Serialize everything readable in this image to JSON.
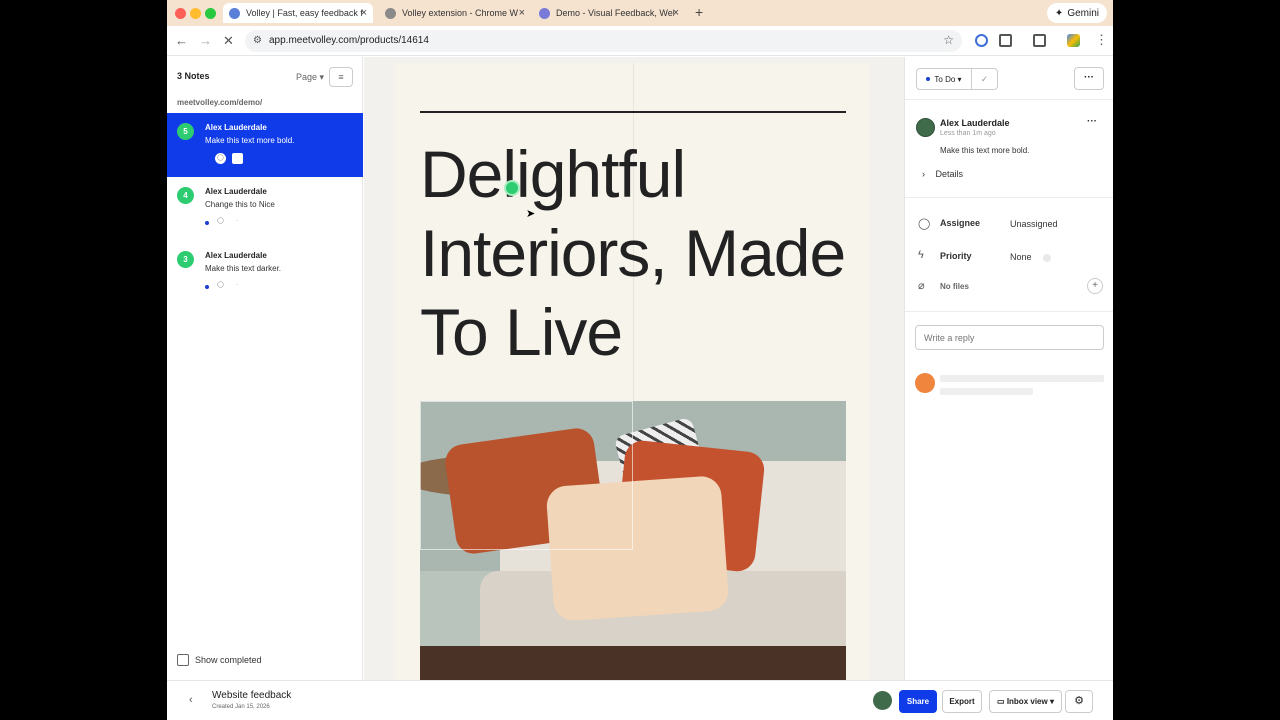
{
  "browser": {
    "tabs": [
      {
        "label": "Volley | Fast, easy feedback f",
        "active": true
      },
      {
        "label": "Volley extension - Chrome W",
        "active": false
      },
      {
        "label": "Demo - Visual Feedback, Web",
        "active": false
      }
    ],
    "gemini_label": "Gemini",
    "url": "app.meetvolley.com/products/14614"
  },
  "left_panel": {
    "notes_count": "3 Notes",
    "page_filter": "Page",
    "site_url": "meetvolley.com/demo/",
    "notes": [
      {
        "number": "5",
        "author": "Alex Lauderdale",
        "message": "Make this text more bold.",
        "selected": true
      },
      {
        "number": "4",
        "author": "Alex Lauderdale",
        "message": "Change this to Nice",
        "selected": false
      },
      {
        "number": "3",
        "author": "Alex Lauderdale",
        "message": "Make this text darker.",
        "selected": false
      }
    ],
    "show_completed": "Show completed"
  },
  "canvas": {
    "headline_line1": "Delightful",
    "headline_line2": "Interiors, Made",
    "headline_line3": "To Live"
  },
  "right_panel": {
    "status": "To Do",
    "author": "Alex Lauderdale",
    "time": "Less than 1m ago",
    "message": "Make this text more bold.",
    "details_label": "Details",
    "assignee_label": "Assignee",
    "assignee_value": "Unassigned",
    "priority_label": "Priority",
    "priority_value": "None",
    "files_label": "No files",
    "reply_placeholder": "Write a reply"
  },
  "bottom_bar": {
    "project_title": "Website feedback",
    "created": "Created Jan 15, 2026",
    "share": "Share",
    "export": "Export",
    "inbox_view": "Inbox view"
  },
  "colors": {
    "accent": "#0f3be8",
    "note_badge": "#2ecc71",
    "tab_strip": "#f6e3cf"
  }
}
